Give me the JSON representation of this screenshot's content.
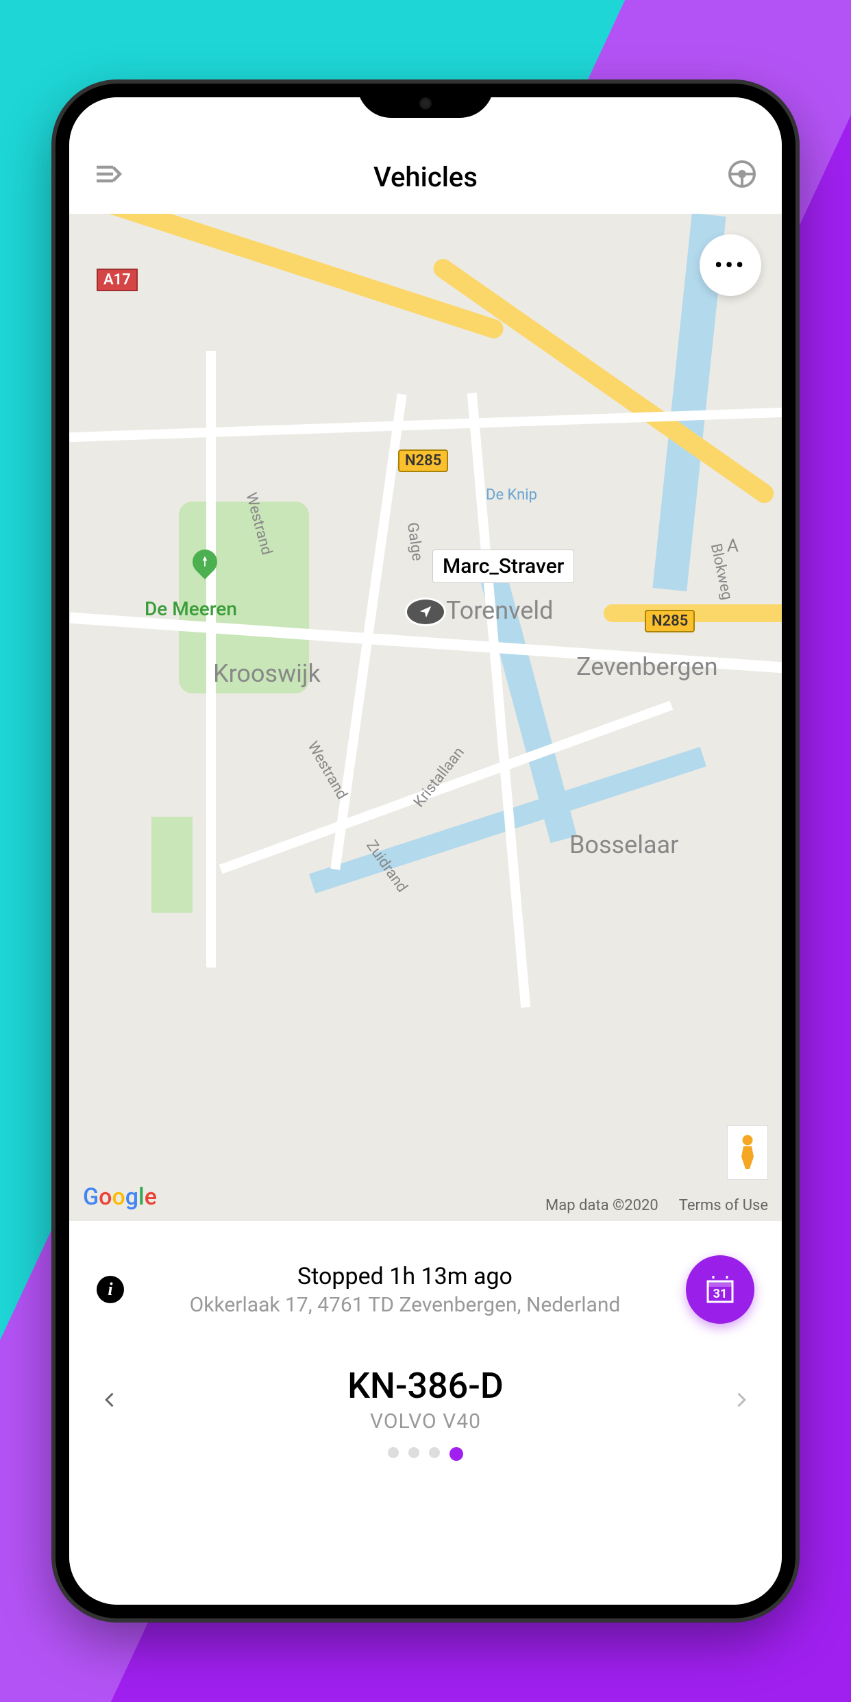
{
  "header": {
    "title": "Vehicles"
  },
  "map": {
    "marker_label": "Marc_Straver",
    "road_badges": {
      "a17": "A17",
      "n285a": "N285",
      "n285b": "N285"
    },
    "places": {
      "de_meeren": "De Meeren",
      "torenveld": "Torenveld",
      "krooswijk": "Krooswijk",
      "zevenbergen": "Zevenbergen",
      "bosselaar": "Bosselaar",
      "de_knip": "De Knip",
      "westrand": "Westrand",
      "westrand2": "Westrand",
      "zuidrand": "Zuidrand",
      "galge": "Galge",
      "blokweg": "Blokweg",
      "kristallaan": "Kristallaan",
      "a_edge": "A"
    },
    "attribution": "Map data ©2020",
    "terms": "Terms of Use",
    "logo": "Google"
  },
  "status": {
    "main": "Stopped 1h 13m ago",
    "address": "Okkerlaak 17, 4761 TD Zevenbergen, Nederland"
  },
  "vehicle": {
    "plate": "KN-386-D",
    "model": "VOLVO V40"
  },
  "calendar": {
    "day": "31"
  },
  "pager": {
    "count": 4,
    "active": 3
  }
}
